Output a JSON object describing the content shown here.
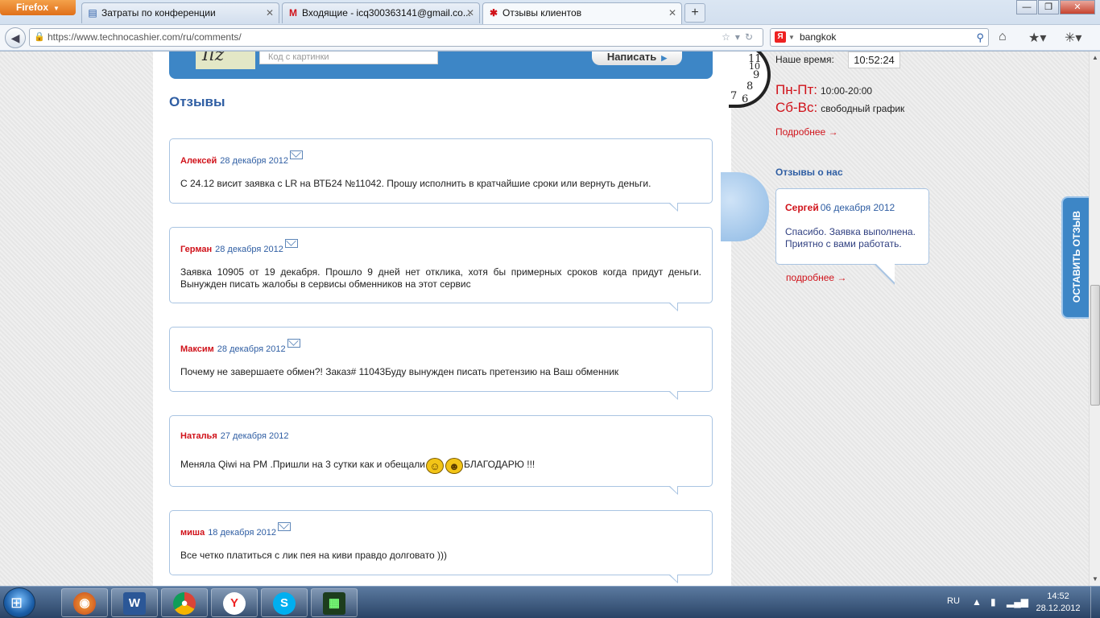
{
  "browser": {
    "menu_label": "Firefox",
    "tabs": [
      {
        "label": "Затраты по конференции",
        "icon": "doc-icon"
      },
      {
        "label": "Входящие - icq300363141@gmail.co...",
        "icon": "gmail-icon"
      },
      {
        "label": "Отзывы клиентов",
        "icon": "site-icon"
      }
    ],
    "url": "https://www.technocashier.com/ru/comments/",
    "search_value": "bangkok",
    "search_engine_letter": "Я"
  },
  "form": {
    "captcha_placeholder": "Код с картинки",
    "captcha_text": "Ilz",
    "submit_label": "Написать"
  },
  "reviews_heading": "Отзывы",
  "reviews": [
    {
      "author": "Алексей",
      "date": "28 декабря 2012",
      "text": "С 24.12 висит заявка с LR на ВТБ24 №11042. Прошу исполнить в кратчайшие сроки или вернуть деньги."
    },
    {
      "author": "Герман",
      "date": "28 декабря 2012",
      "text": "Заявка 10905 от 19 декабря. Прошло 9 дней нет отклика, хотя бы примерных сроков когда придут деньги. Вынужден писать жалобы в сервисы обменников на этот сервис"
    },
    {
      "author": "Максим",
      "date": "28 декабря 2012",
      "text": "Почему не завершаете обмен?! Заказ# 11043Буду вынужден писать претензию на Ваш обменник"
    },
    {
      "author": "Наталья",
      "date": "27 декабря 2012",
      "text_before": "Меняла Qiwi на РМ .Пришли на 3 сутки как и обещали",
      "text_after": "БЛАГОДАРЮ !!!"
    },
    {
      "author": "миша",
      "date": "18 декабря 2012",
      "text": "Все четко платиться с лик пея на киви правдо долговато )))"
    }
  ],
  "sidebar": {
    "time_label": "Наше время:",
    "time_value": "10:52:24",
    "weekdays_label": "Пн-Пт:",
    "weekdays_hours": "10:00-20:00",
    "weekend_label": "Сб-Вс:",
    "weekend_hours": "свободный график",
    "more_link": "Подробнее →",
    "about_heading": "Отзывы о нас",
    "side_review": {
      "author": "Сергей",
      "date": "06 декабря 2012",
      "text": "Спасибо. Заявка выполнена. Приятно с вами работать."
    },
    "side_more_link": "подробнее →",
    "leave_review_label": "ОСТАВИТЬ ОТЗЫВ"
  },
  "taskbar": {
    "apps": [
      "firefox-icon",
      "word-icon",
      "chrome-icon",
      "yandex-icon",
      "skype-icon",
      "monitor-app-icon"
    ],
    "language": "RU",
    "time": "14:52",
    "date": "28.12.2012"
  }
}
